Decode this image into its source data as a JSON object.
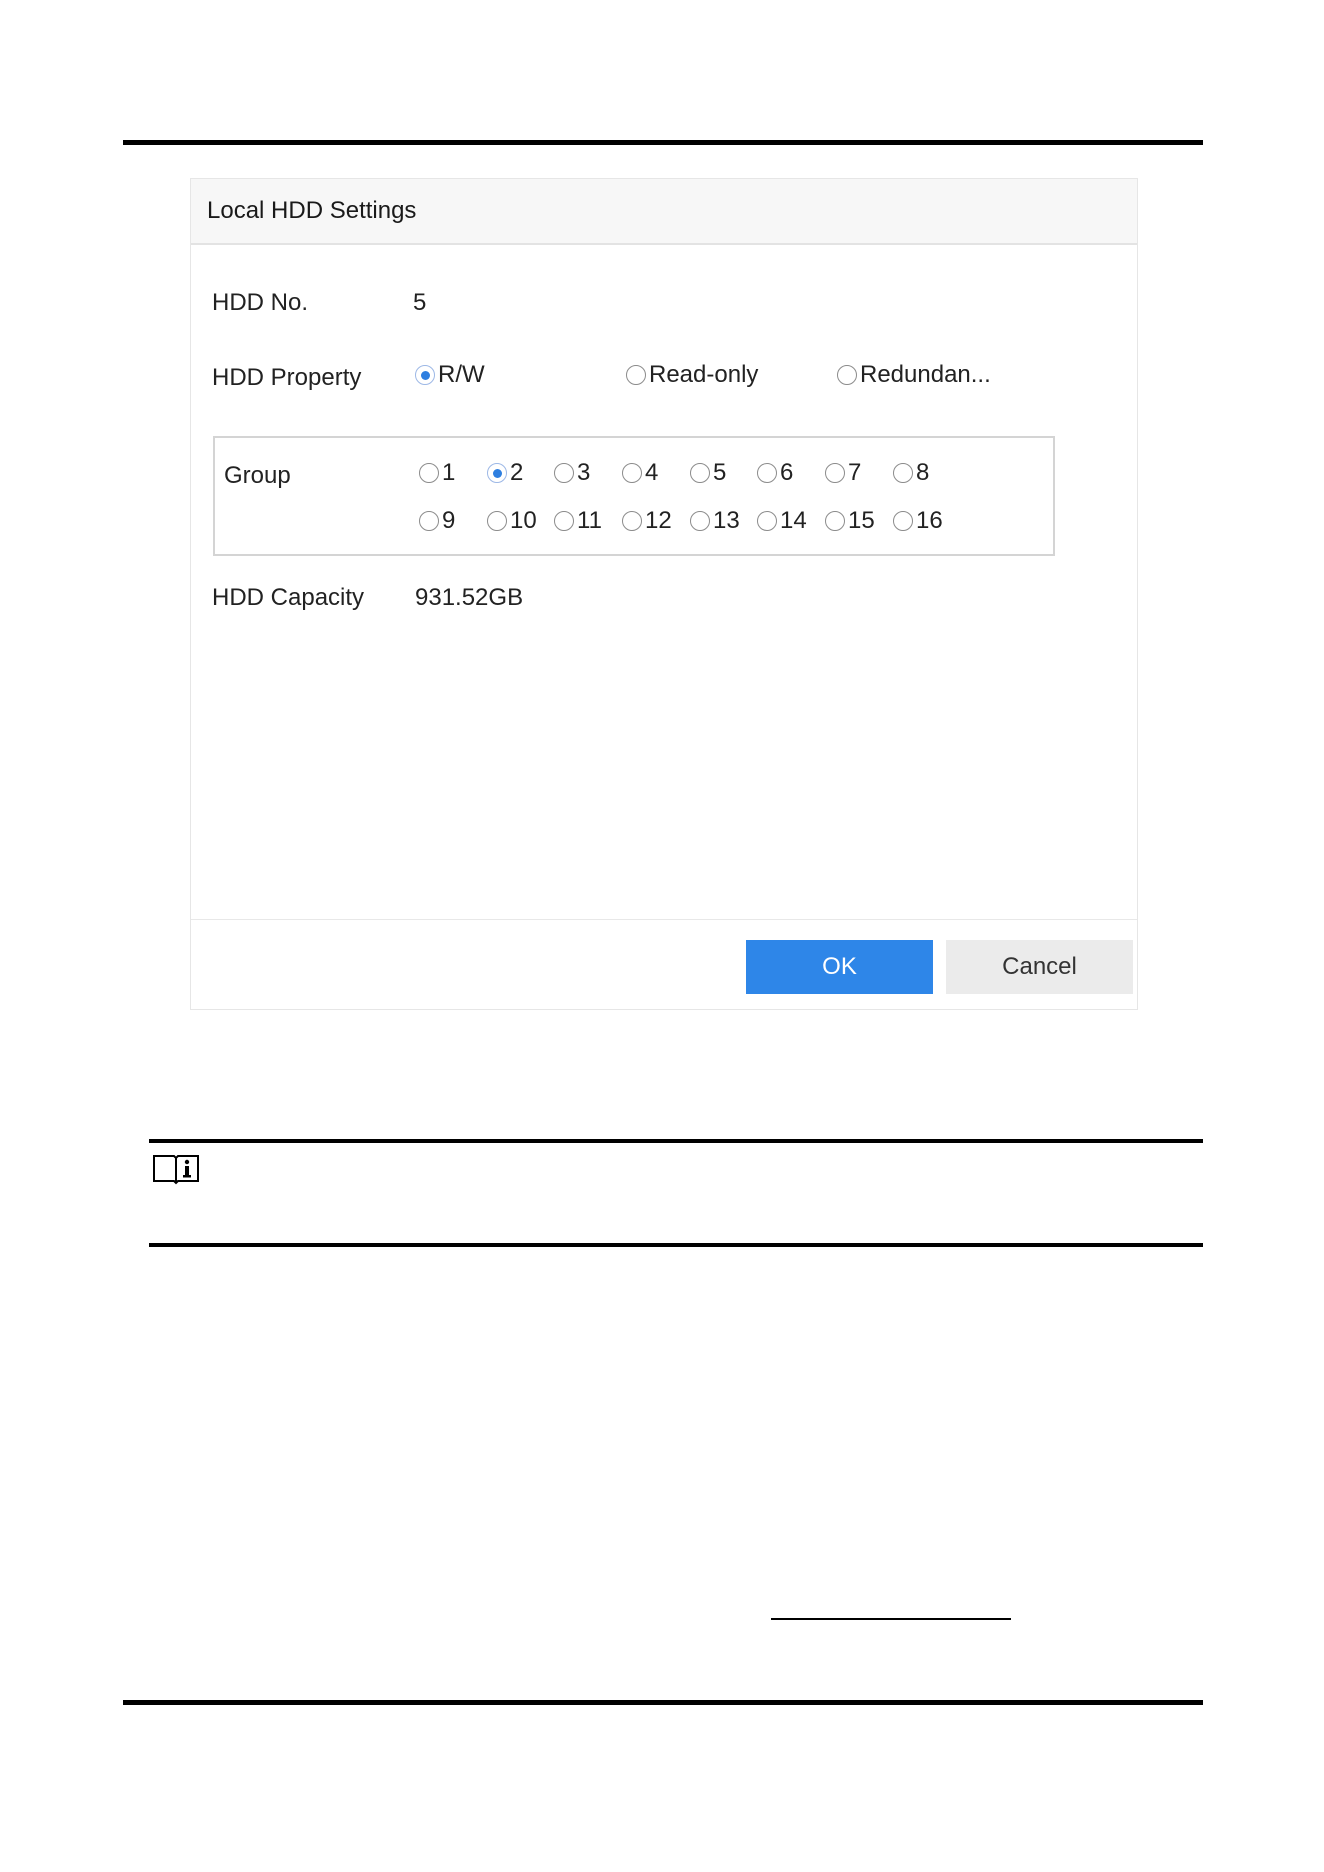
{
  "dialog": {
    "title": "Local HDD Settings",
    "hdd_no": {
      "label": "HDD No.",
      "value": "5"
    },
    "hdd_property": {
      "label": "HDD Property",
      "options": [
        "R/W",
        "Read-only",
        "Redundan..."
      ],
      "selected": "R/W"
    },
    "group": {
      "label": "Group",
      "options": [
        "1",
        "2",
        "3",
        "4",
        "5",
        "6",
        "7",
        "8",
        "9",
        "10",
        "11",
        "12",
        "13",
        "14",
        "15",
        "16"
      ],
      "selected": "2"
    },
    "hdd_capacity": {
      "label": "HDD Capacity",
      "value": "931.52GB"
    },
    "ok_label": "OK",
    "cancel_label": "Cancel"
  },
  "note": {
    "icon": "note-book-icon"
  },
  "colors": {
    "accent": "#2e86e8",
    "radio_dot": "#2e7fe0"
  }
}
